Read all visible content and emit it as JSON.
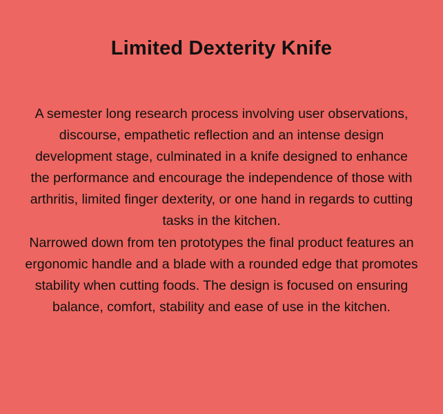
{
  "background_color": "#ED6661",
  "text_color": "#111111",
  "title": "Limited Dexterity Knife",
  "paragraphs": [
    "A semester long research process involving user observations, discourse, empathetic reflection and an intense design development stage, culminated in a knife designed to enhance the performance and encourage the independence of those with arthritis, limited finger dexterity, or one hand in regards to cutting tasks in the kitchen.",
    "Narrowed down from ten prototypes the final product features an ergonomic handle and a blade with a rounded edge that promotes stability when cutting foods. The design is focused on ensuring balance, comfort, stability and ease of use in the kitchen."
  ]
}
